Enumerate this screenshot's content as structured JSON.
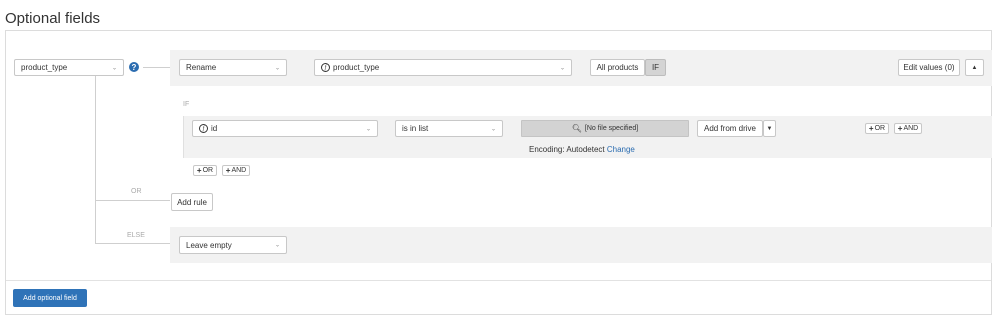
{
  "page": {
    "title": "Optional fields"
  },
  "field": {
    "name": "product_type",
    "help_icon": "question-circle-icon"
  },
  "mapping": {
    "mode": "Rename",
    "source_field": "product_type",
    "all_products_label": "All products",
    "if_label": "IF",
    "edit_values_label": "Edit values (0)",
    "collapse_glyph": "▲"
  },
  "condition": {
    "section_label": "IF",
    "field": "id",
    "operator": "is in list",
    "file_label": "[No file specified]",
    "add_from_drive_label": "Add from drive",
    "or_label": "OR",
    "and_label": "AND",
    "encoding_label": "Encoding: Autodetect",
    "change_label": "Change"
  },
  "rule_group": {
    "or_label": "OR",
    "and_label": "AND"
  },
  "or_branch": {
    "label": "OR",
    "add_rule_label": "Add rule"
  },
  "else_branch": {
    "label": "ELSE",
    "value": "Leave empty"
  },
  "footer": {
    "add_optional_field_label": "Add optional field"
  }
}
